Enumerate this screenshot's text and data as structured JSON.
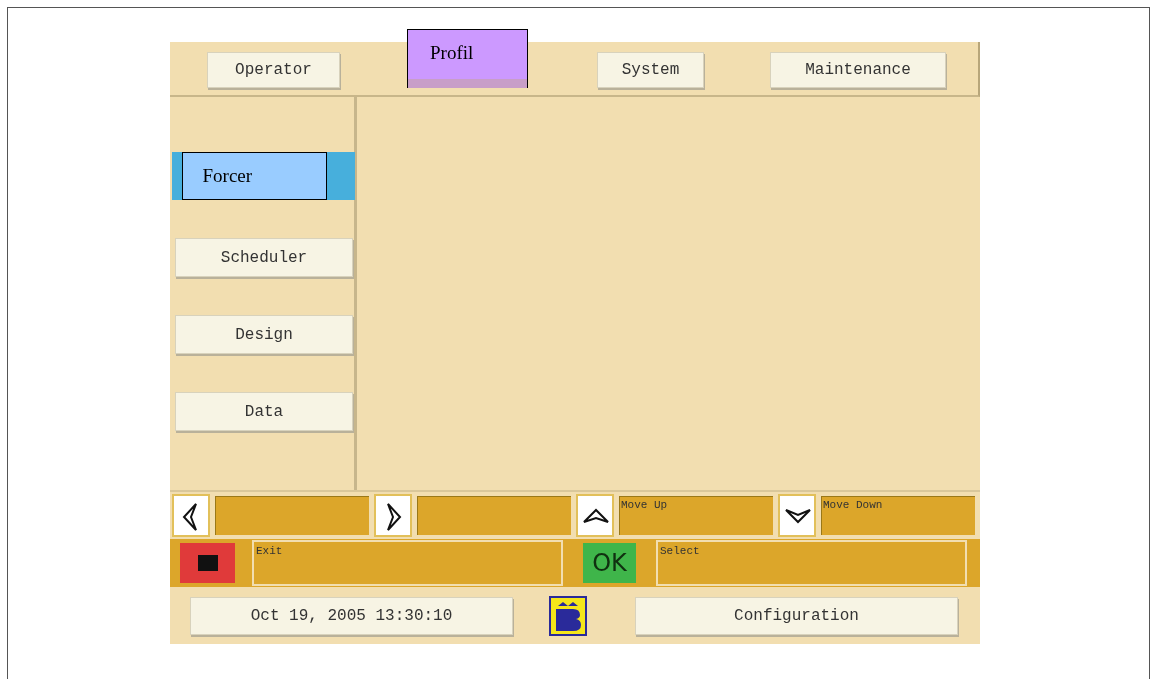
{
  "tabs": [
    {
      "label": "Operator",
      "selected": false
    },
    {
      "label": "Profil",
      "selected": true
    },
    {
      "label": "System",
      "selected": false
    },
    {
      "label": "Maintenance",
      "selected": false
    }
  ],
  "side_menu": [
    {
      "label": "Forcer",
      "selected": true
    },
    {
      "label": "Scheduler",
      "selected": false
    },
    {
      "label": "Design",
      "selected": false
    },
    {
      "label": "Data",
      "selected": false
    }
  ],
  "nav_keys": [
    {
      "kind": "left"
    },
    {
      "kind": "right"
    },
    {
      "kind": "up",
      "label": "Move Up"
    },
    {
      "kind": "down",
      "label": "Move Down"
    }
  ],
  "action_keys": [
    {
      "kind": "stop",
      "label": "Exit"
    },
    {
      "kind": "ok",
      "key": "OK",
      "label": "Select"
    }
  ],
  "status_bar": {
    "datetime": "Oct 19, 2005 13:30:10",
    "button": "Configuration"
  }
}
